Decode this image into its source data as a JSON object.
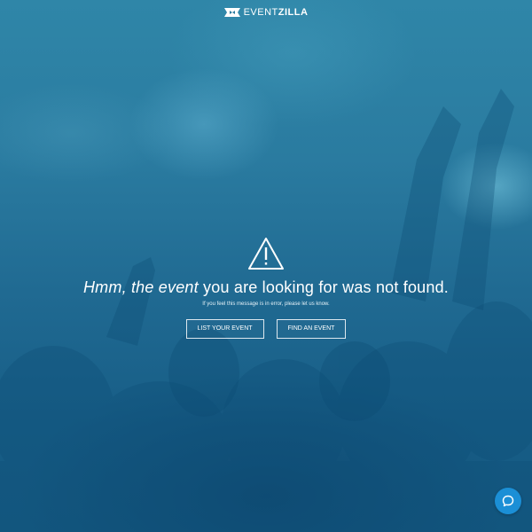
{
  "header": {
    "logo_text_light": "EVENT",
    "logo_text_bold": "ZILLA"
  },
  "error": {
    "icon": "warning-triangle-icon",
    "headline_italic": "Hmm, the event",
    "headline_rest": " you are looking for was not found.",
    "subtext": "If you feel this message is in error, please let us know."
  },
  "actions": {
    "list_event_label": "LIST YOUR EVENT",
    "find_event_label": "FIND AN EVENT"
  },
  "chat": {
    "icon": "chat-bubble-icon",
    "color": "#1b8fd6"
  },
  "colors": {
    "background_overlay": "#206a92",
    "text": "#ffffff"
  }
}
